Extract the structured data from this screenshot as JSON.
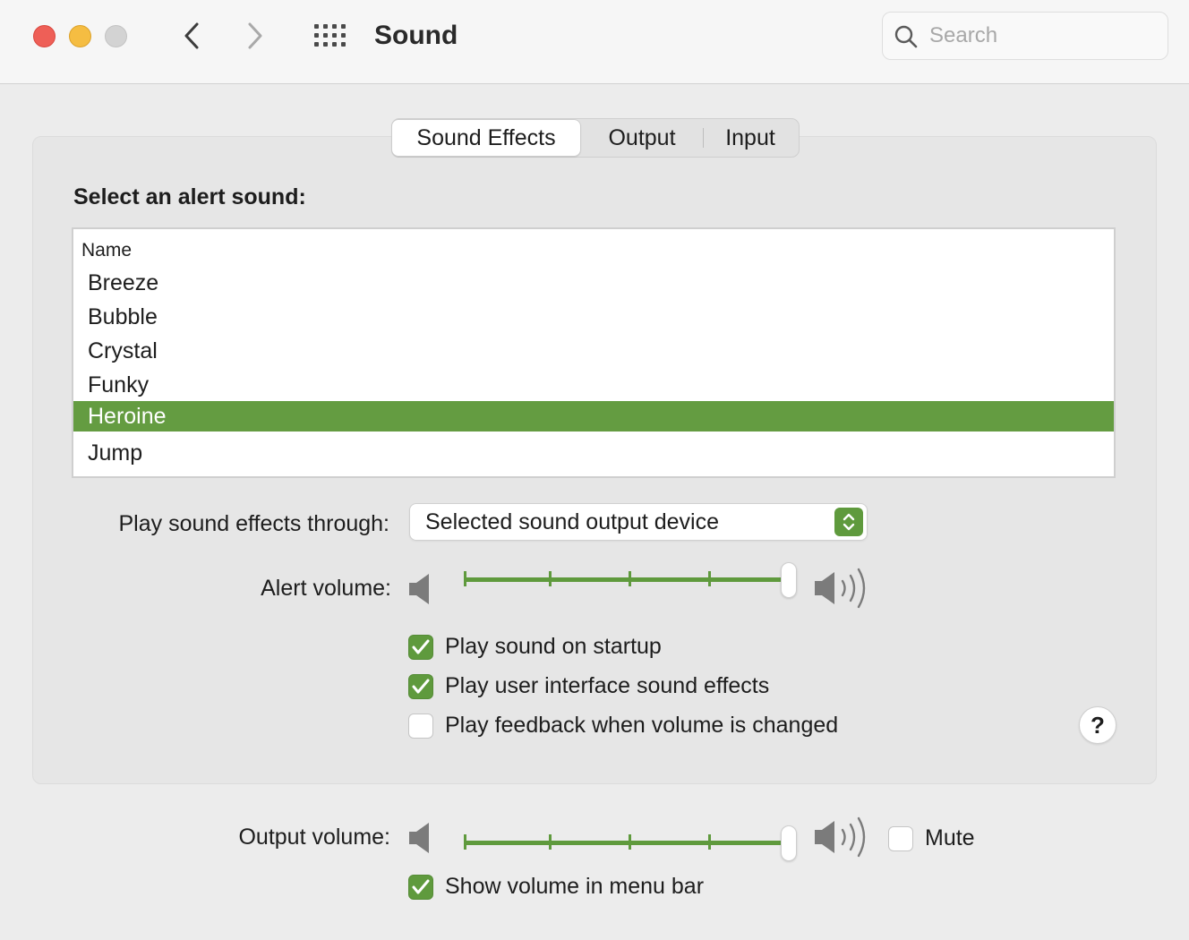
{
  "window": {
    "title": "Sound",
    "search_placeholder": "Search"
  },
  "tabs": [
    {
      "label": "Sound Effects",
      "selected": true
    },
    {
      "label": "Output",
      "selected": false
    },
    {
      "label": "Input",
      "selected": false
    }
  ],
  "sound_effects": {
    "section_label": "Select an alert sound:",
    "list_header": "Name",
    "sounds": [
      {
        "name": "Breeze",
        "selected": false
      },
      {
        "name": "Bubble",
        "selected": false
      },
      {
        "name": "Crystal",
        "selected": false
      },
      {
        "name": "Funky",
        "selected": false
      },
      {
        "name": "Heroine",
        "selected": true
      },
      {
        "name": "Jump",
        "selected": false
      }
    ],
    "play_through_label": "Play sound effects through:",
    "play_through_value": "Selected sound output device",
    "alert_volume_label": "Alert volume:",
    "alert_volume_level": 1.0,
    "checkboxes": [
      {
        "label": "Play sound on startup",
        "checked": true
      },
      {
        "label": "Play user interface sound effects",
        "checked": true
      },
      {
        "label": "Play feedback when volume is changed",
        "checked": false
      }
    ],
    "help_label": "?"
  },
  "output": {
    "output_volume_label": "Output volume:",
    "output_volume_level": 1.0,
    "mute_label": "Mute",
    "mute_checked": false,
    "show_in_menu_bar_label": "Show volume in menu bar",
    "show_in_menu_bar_checked": true
  },
  "colors": {
    "accent": "#5f9a3d",
    "selection": "#649c41",
    "close": "#ee5f57",
    "minimize": "#f5bd42",
    "zoom_disabled": "#d3d3d3"
  }
}
